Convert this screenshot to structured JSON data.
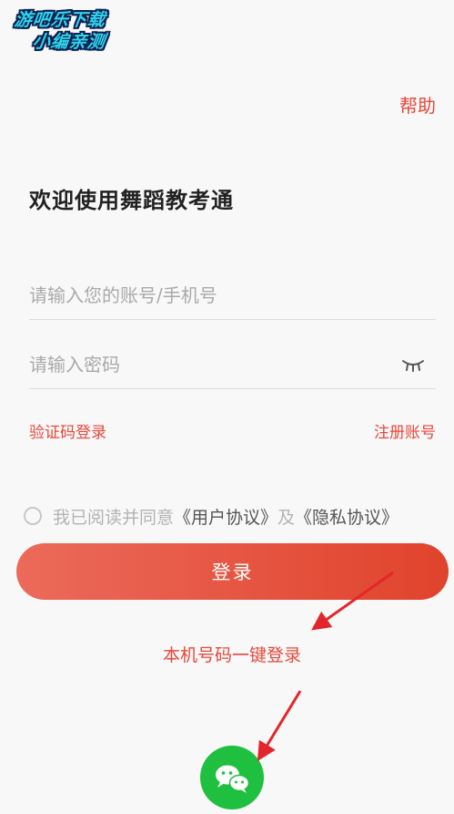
{
  "watermark": {
    "line1": "游吧乐下载",
    "line2": "小编亲测"
  },
  "header": {
    "help_label": "帮助"
  },
  "welcome": {
    "title": "欢迎使用舞蹈教考通"
  },
  "form": {
    "account_placeholder": "请输入您的账号/手机号",
    "password_placeholder": "请输入密码",
    "eye_icon": "eye-closed-icon"
  },
  "links": {
    "sms_login": "验证码登录",
    "register": "注册账号"
  },
  "agreement": {
    "prefix": "我已阅读并同意",
    "user_agreement": "《用户协议》",
    "conjunction": "及",
    "privacy_agreement": "《隐私协议》"
  },
  "actions": {
    "login_label": "登录",
    "one_click_login": "本机号码一键登录"
  },
  "social": {
    "wechat_icon": "wechat-icon"
  },
  "colors": {
    "accent": "#e8473a",
    "button_start": "#ec6a5a",
    "button_end": "#e0432c",
    "wechat": "#1fbf3f",
    "annotation_arrow": "#e3262b"
  }
}
